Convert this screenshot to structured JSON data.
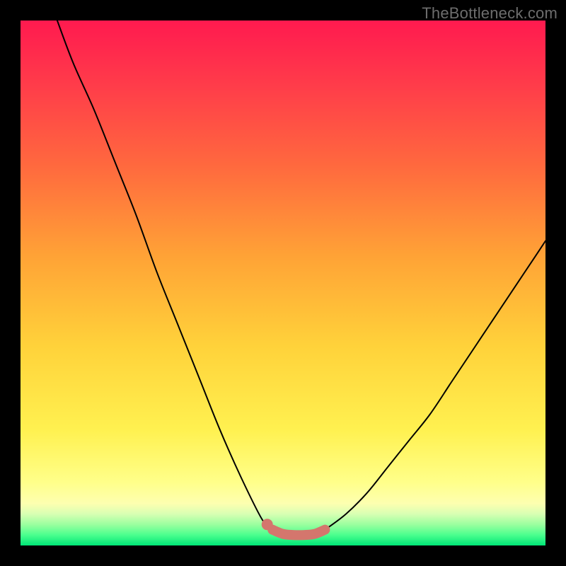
{
  "watermark": "TheBottleneck.com",
  "colors": {
    "frame_bg": "#000000",
    "curve": "#000000",
    "accent": "#d4766d"
  },
  "chart_data": {
    "type": "line",
    "title": "",
    "xlabel": "",
    "ylabel": "",
    "xlim": [
      0,
      100
    ],
    "ylim": [
      0,
      100
    ],
    "series": [
      {
        "name": "left-descending-curve",
        "x": [
          7,
          10,
          14,
          18,
          22,
          26,
          30,
          34,
          38,
          42,
          46,
          48
        ],
        "values": [
          100,
          92,
          83,
          73,
          63,
          52,
          42,
          32,
          22,
          13,
          5,
          3
        ]
      },
      {
        "name": "right-ascending-curve",
        "x": [
          58,
          62,
          66,
          70,
          74,
          78,
          82,
          86,
          90,
          94,
          98,
          100
        ],
        "values": [
          3,
          6,
          10,
          15,
          20,
          25,
          31,
          37,
          43,
          49,
          55,
          58
        ]
      },
      {
        "name": "bottom-flat-highlight",
        "x": [
          48,
          50,
          52,
          54,
          56,
          58
        ],
        "values": [
          3,
          2.2,
          2,
          2,
          2.2,
          3
        ]
      }
    ],
    "accent_point": {
      "x": 47,
      "y": 4
    }
  }
}
